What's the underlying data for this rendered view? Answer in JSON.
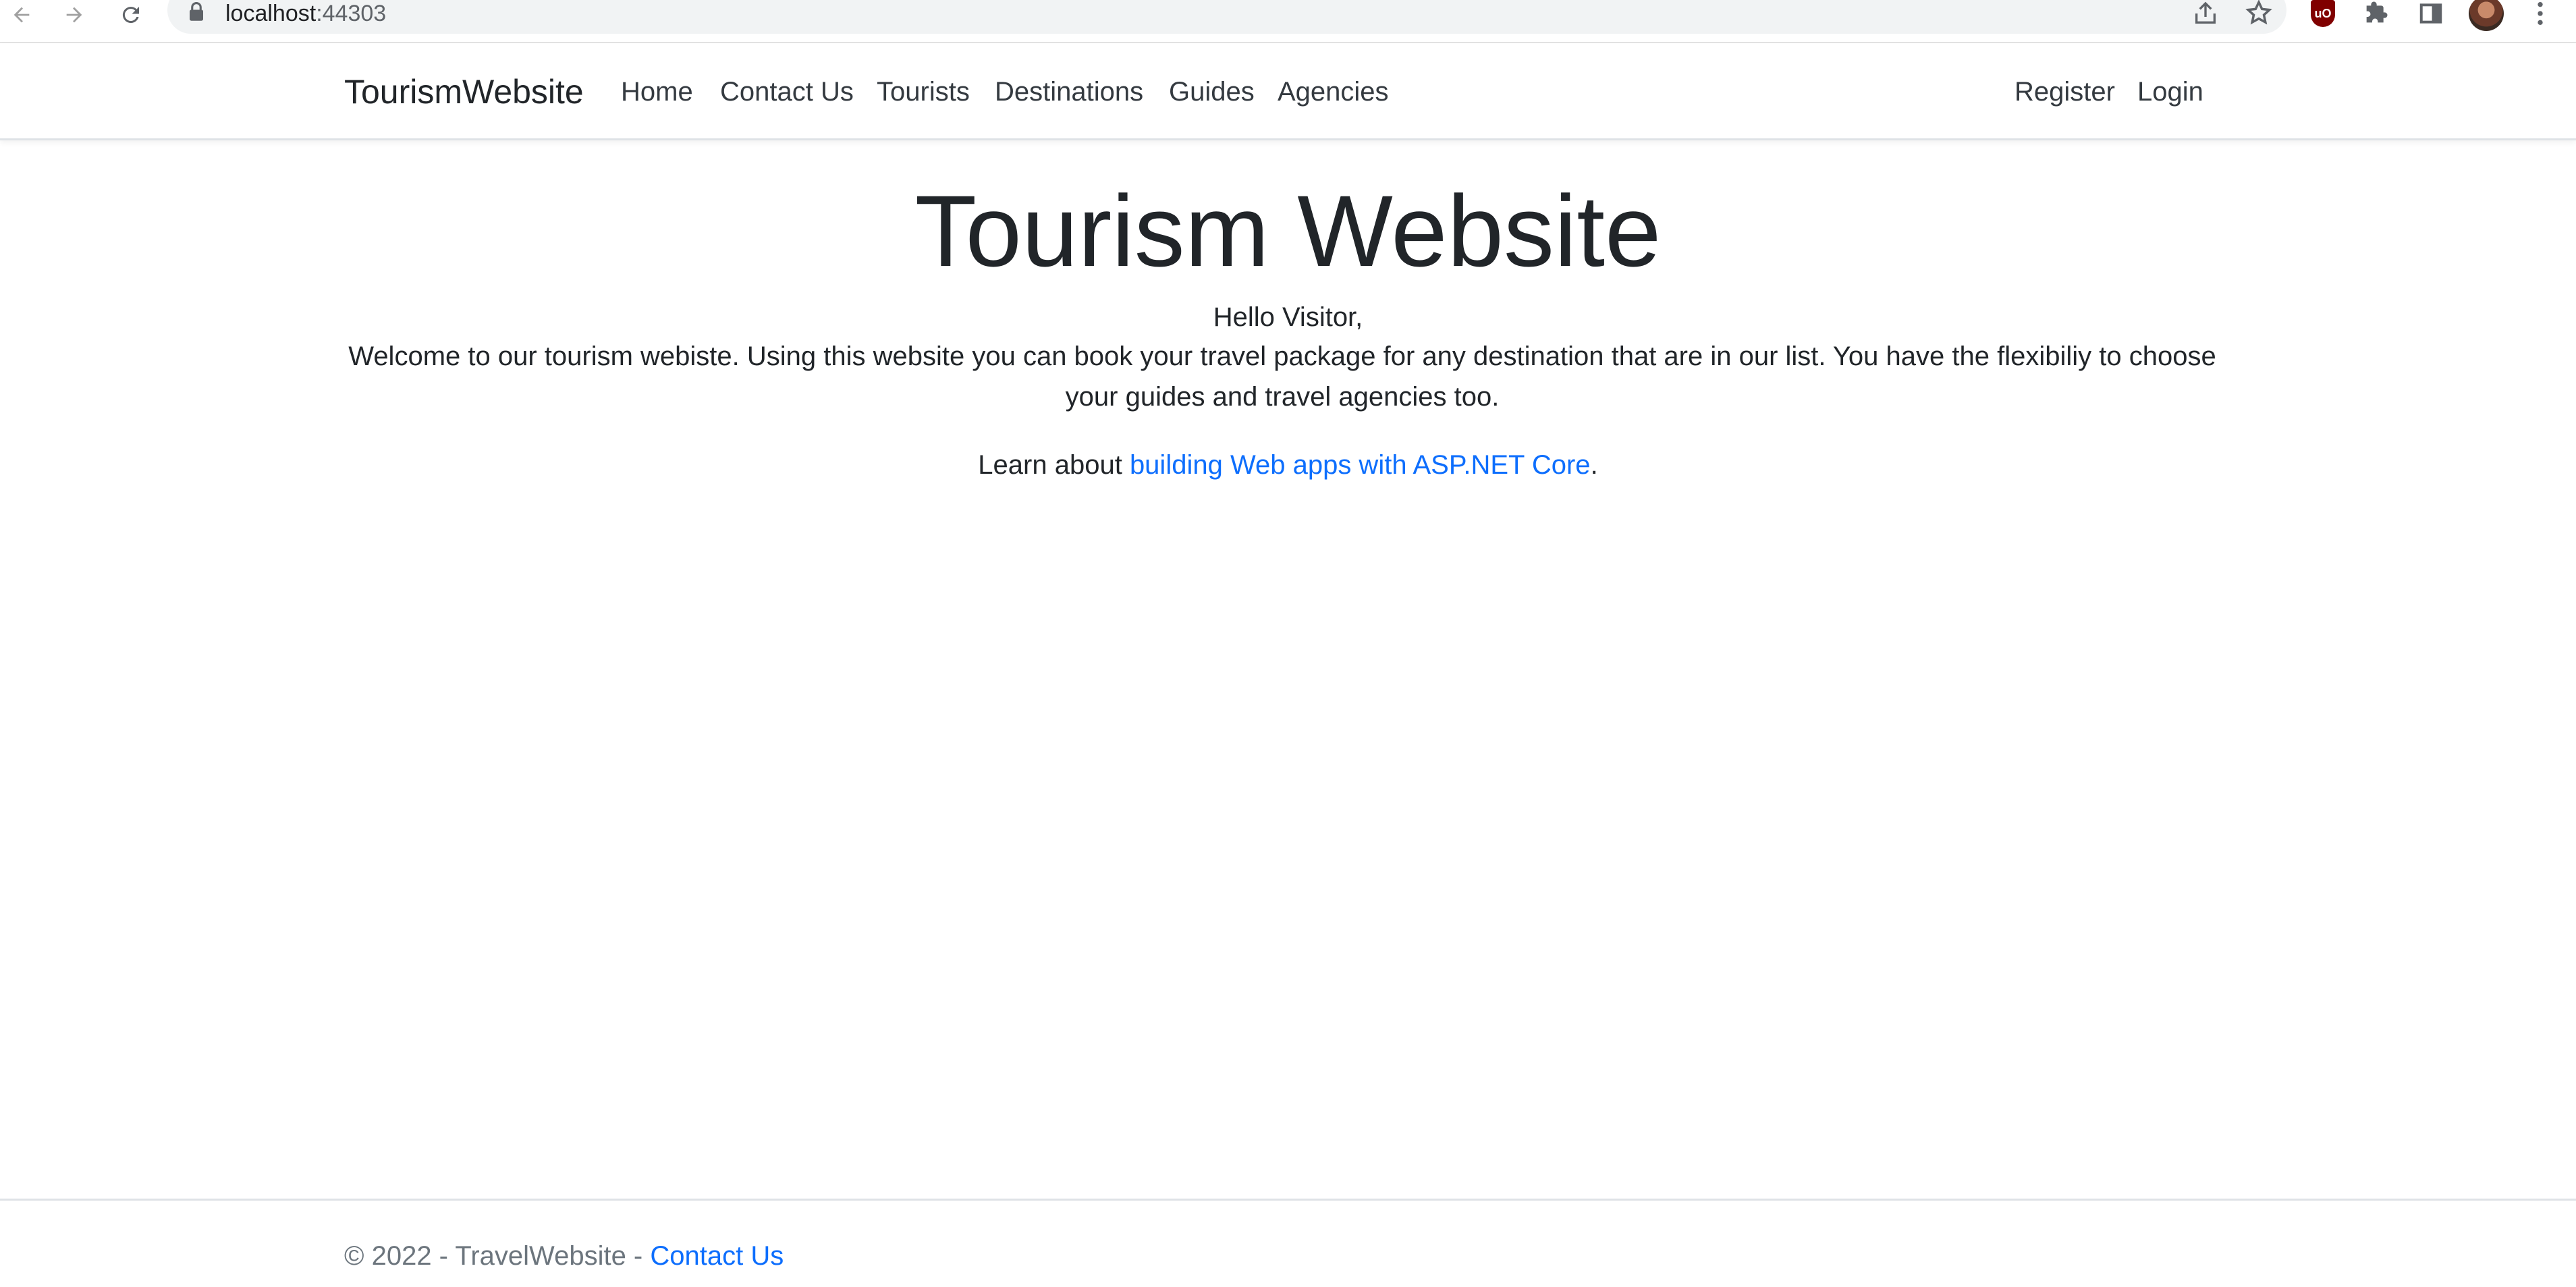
{
  "browser": {
    "url_host": "localhost",
    "url_port": ":44303",
    "icons": [
      "back-icon",
      "forward-icon",
      "reload-icon",
      "lock-icon",
      "share-icon",
      "star-icon",
      "ublock-icon",
      "extensions-icon",
      "side-panel-icon",
      "profile-avatar",
      "menu-icon"
    ],
    "ublock_label": "uO"
  },
  "navbar": {
    "brand": "TourismWebsite",
    "links": [
      "Home",
      "Contact Us",
      "Tourists",
      "Destinations",
      "Guides",
      "Agencies"
    ],
    "right_links": [
      "Register",
      "Login"
    ]
  },
  "main": {
    "title": "Tourism Website",
    "greeting": "Hello Visitor,",
    "intro": "Welcome to our tourism webiste. Using this website you can book your travel package for any destination that are in our list. You have the flexibiliy to choose your guides and travel agencies too.",
    "learn_prefix": "Learn about ",
    "learn_link": "building Web apps with ASP.NET Core",
    "learn_suffix": "."
  },
  "footer": {
    "copyright": "© 2022 - TravelWebsite - ",
    "contact_link": "Contact Us"
  },
  "colors": {
    "link": "#0d6efd",
    "text": "#212529",
    "muted": "#6c757d"
  }
}
